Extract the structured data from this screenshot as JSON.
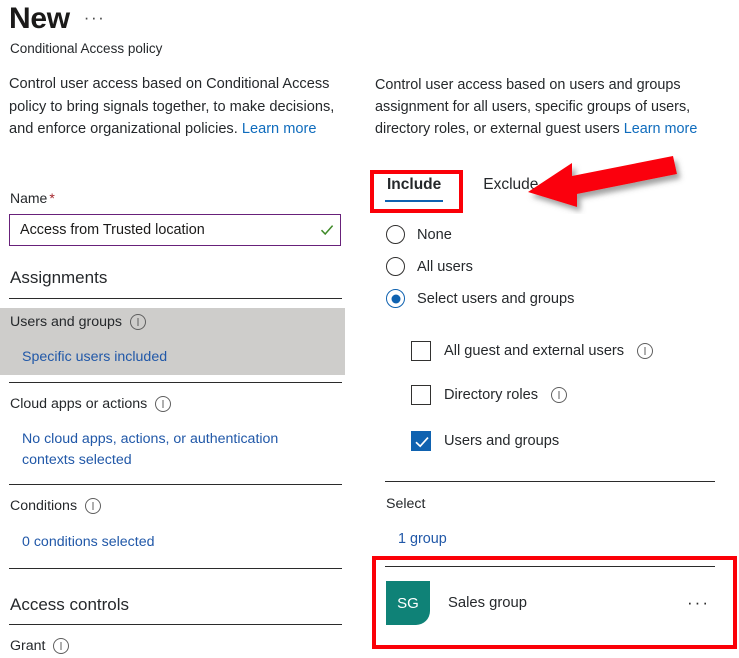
{
  "header": {
    "title": "New",
    "more_menu": "···",
    "subtitle": "Conditional Access policy"
  },
  "left_panel": {
    "intro_text": "Control user access based on Conditional Access policy to bring signals together, to make decisions, and enforce organizational policies. ",
    "intro_link": "Learn more",
    "name_label": "Name",
    "name_required_mark": "*",
    "name_value": "Access from Trusted location",
    "name_placeholder": "",
    "assignments_heading": "Assignments",
    "fields": [
      {
        "label": "Users and groups",
        "value": "Specific users included"
      },
      {
        "label": "Cloud apps or actions",
        "value": "No cloud apps, actions, or authentication contexts selected"
      },
      {
        "label": "Conditions",
        "value": "0 conditions selected"
      }
    ],
    "access_controls_heading": "Access controls",
    "grant_label": "Grant"
  },
  "right_panel": {
    "intro_text": "Control user access based on users and groups assignment for all users, specific groups of users, directory roles, or external guest users ",
    "intro_link": "Learn more",
    "tabs": [
      {
        "label": "Include",
        "active": true
      },
      {
        "label": "Exclude",
        "active": false
      }
    ],
    "radios": [
      {
        "label": "None",
        "selected": false
      },
      {
        "label": "All users",
        "selected": false
      },
      {
        "label": "Select users and groups",
        "selected": true
      }
    ],
    "checkboxes": [
      {
        "label": "All guest and external users",
        "checked": false,
        "has_info": true
      },
      {
        "label": "Directory roles",
        "checked": false,
        "has_info": true
      },
      {
        "label": "Users and groups",
        "checked": true,
        "has_info": false
      }
    ],
    "select_label": "Select",
    "group_count_link": "1 group",
    "selected_group": {
      "initials": "SG",
      "name": "Sales group",
      "row_menu": "···"
    }
  },
  "colors": {
    "annotation_red": "#fb0007",
    "accent_blue": "#0f62b0",
    "link_blue": "#2158a8",
    "input_border_purple": "#68217a",
    "avatar_teal": "#0f8277",
    "valid_green": "#3f8a28",
    "highlight_gray": "#cecdcb"
  }
}
